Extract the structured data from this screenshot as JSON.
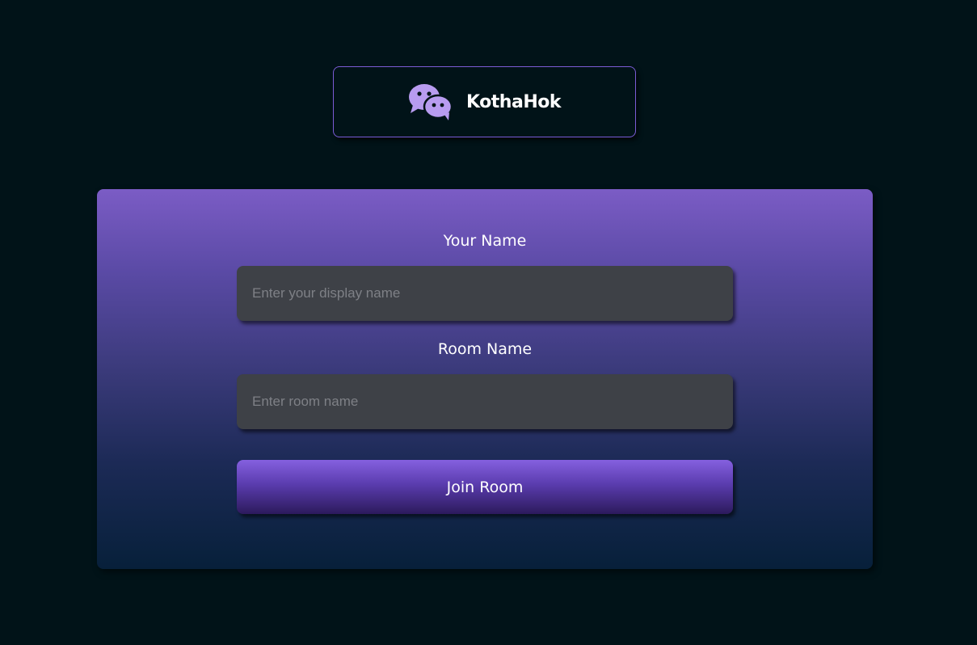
{
  "header": {
    "logo_icon": "chat-bubbles-icon",
    "app_name": "KothaHok"
  },
  "form": {
    "name_label": "Your Name",
    "name_placeholder": "Enter your display name",
    "name_value": "",
    "room_label": "Room Name",
    "room_placeholder": "Enter room name",
    "room_value": "",
    "join_label": "Join Room"
  },
  "colors": {
    "background": "#011318",
    "accent": "#7a5cd6",
    "logo_icon": "#b89cf0",
    "input_background": "#3e4147",
    "card_gradient_top": "#7b5cc5",
    "card_gradient_bottom": "#07203a"
  }
}
